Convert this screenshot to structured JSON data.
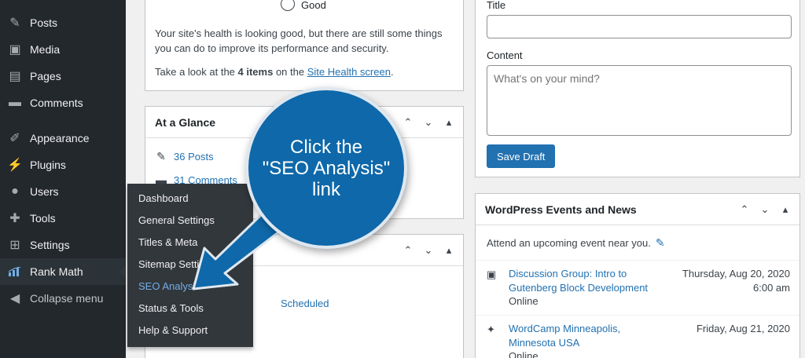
{
  "sidebar": {
    "items": [
      {
        "label": "Posts",
        "icon": "pin-icon"
      },
      {
        "label": "Media",
        "icon": "media-icon"
      },
      {
        "label": "Pages",
        "icon": "pages-icon"
      },
      {
        "label": "Comments",
        "icon": "comment-icon"
      },
      {
        "label": "Appearance",
        "icon": "brush-icon"
      },
      {
        "label": "Plugins",
        "icon": "plugin-icon"
      },
      {
        "label": "Users",
        "icon": "user-icon"
      },
      {
        "label": "Tools",
        "icon": "wrench-icon"
      },
      {
        "label": "Settings",
        "icon": "settings-icon"
      },
      {
        "label": "Rank Math",
        "icon": "rank-math-icon"
      },
      {
        "label": "Collapse menu",
        "icon": "collapse-icon"
      }
    ],
    "submenu": [
      "Dashboard",
      "General Settings",
      "Titles & Meta",
      "Sitemap Settings",
      "SEO Analysis",
      "Status & Tools",
      "Help & Support"
    ]
  },
  "health": {
    "good_label": "Good",
    "text": "Your site's health is looking good, but there are still some things you can do to improve its performance and security.",
    "look_prefix": "Take a look at the ",
    "items_count": "4 items",
    "look_middle": " on the ",
    "link_label": "Site Health screen",
    "look_suffix": "."
  },
  "glance": {
    "title": "At a Glance",
    "posts": "36 Posts",
    "comments": "31 Comments"
  },
  "activity": {
    "scheduled_tab": "Scheduled"
  },
  "draft": {
    "title_label": "Title",
    "content_label": "Content",
    "content_placeholder": "What's on your mind?",
    "save_label": "Save Draft"
  },
  "events": {
    "title": "WordPress Events and News",
    "intro": "Attend an upcoming event near you.",
    "list": [
      {
        "title": "Discussion Group: Intro to Gutenberg Block Development",
        "location": "Online",
        "date": "Thursday, Aug 20, 2020",
        "time": "6:00 am"
      },
      {
        "title": "WordCamp Minneapolis, Minnesota USA",
        "location": "Online",
        "date": "Friday, Aug 21, 2020",
        "time": ""
      }
    ]
  },
  "callout": {
    "line1": "Click the",
    "line2": "\"SEO Analysis\"",
    "line3": "link"
  },
  "colors": {
    "sidebar": "#23282d",
    "accent": "#2271b1",
    "callout": "#0e68a9"
  }
}
